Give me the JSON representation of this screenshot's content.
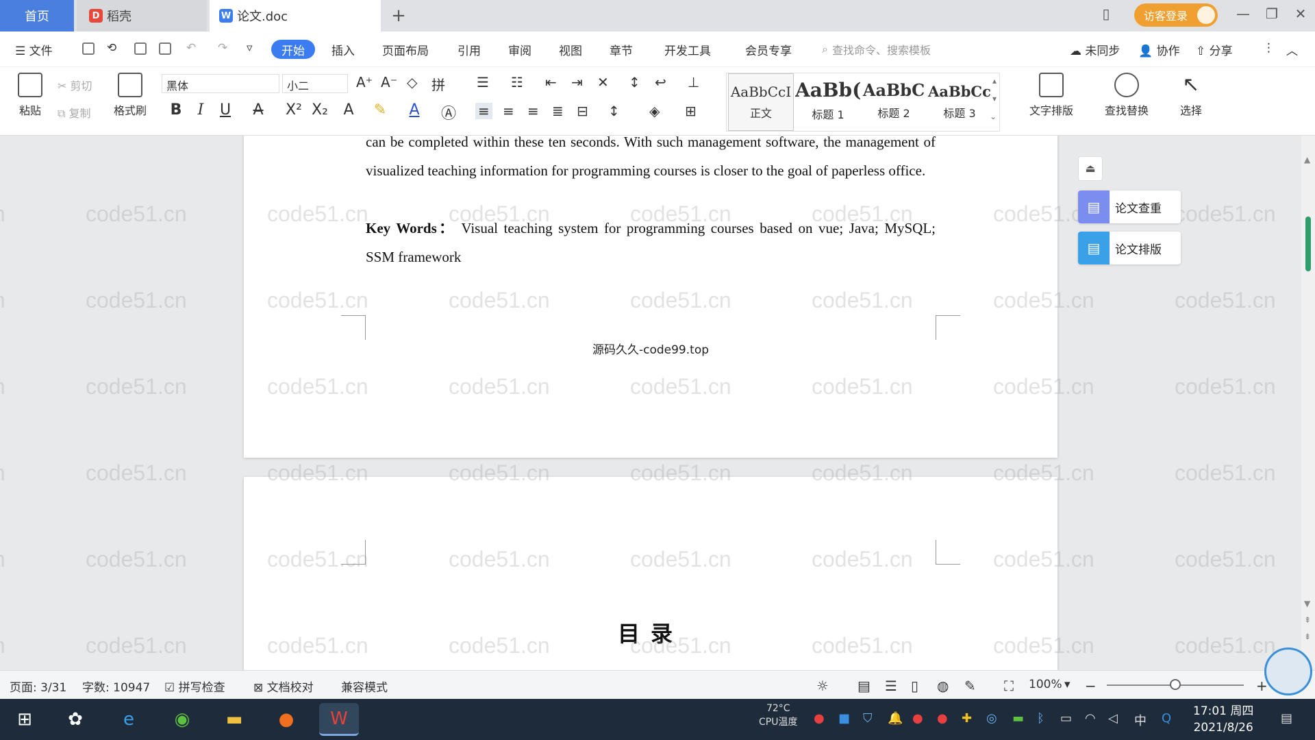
{
  "tabs": {
    "home": "首页",
    "daoke": "稻壳",
    "doc": "论文.doc",
    "new_tab": "+"
  },
  "titlebar": {
    "login": "访客登录"
  },
  "menu": {
    "file": "文件",
    "items": [
      "开始",
      "插入",
      "页面布局",
      "引用",
      "审阅",
      "视图",
      "章节",
      "开发工具",
      "会员专享"
    ],
    "search_placeholder": "查找命令、搜索模板",
    "sync": "未同步",
    "collab": "协作",
    "share": "分享"
  },
  "ribbon": {
    "paste": "粘贴",
    "cut": "剪切",
    "copy": "复制",
    "format_painter": "格式刷",
    "font_name": "黑体",
    "font_size": "小二",
    "styles": [
      {
        "sample": "AaBbCcI",
        "name": "正文"
      },
      {
        "sample": "AaBb(",
        "name": "标题 1"
      },
      {
        "sample": "AaBbC",
        "name": "标题 2"
      },
      {
        "sample": "AaBbCc",
        "name": "标题 3"
      }
    ],
    "text_layout": "文字排版",
    "find_replace": "查找替换",
    "select": "选择"
  },
  "document": {
    "page1_text": "can be completed within these ten seconds. With such management software, the management of visualized teaching information for programming courses is closer to the goal of paperless office.",
    "keywords_label": "Key Words：",
    "keywords_text": " Visual teaching system for programming courses based on vue; Java; MySQL; SSM framework",
    "footer": "源码久久-code99.top",
    "toc_title": "目录",
    "watermark": "code51.cn"
  },
  "side_panel": {
    "check": "论文查重",
    "layout": "论文排版"
  },
  "status": {
    "page": "页面: 3/31",
    "words": "字数: 10947",
    "spell": "拼写检查",
    "proof": "文档校对",
    "compat": "兼容模式",
    "zoom": "100%",
    "zoom_level": 0.5
  },
  "taskbar": {
    "temp": "72°C",
    "temp_label": "CPU温度",
    "ime": "中",
    "time": "17:01 周四",
    "date": "2021/8/26"
  }
}
